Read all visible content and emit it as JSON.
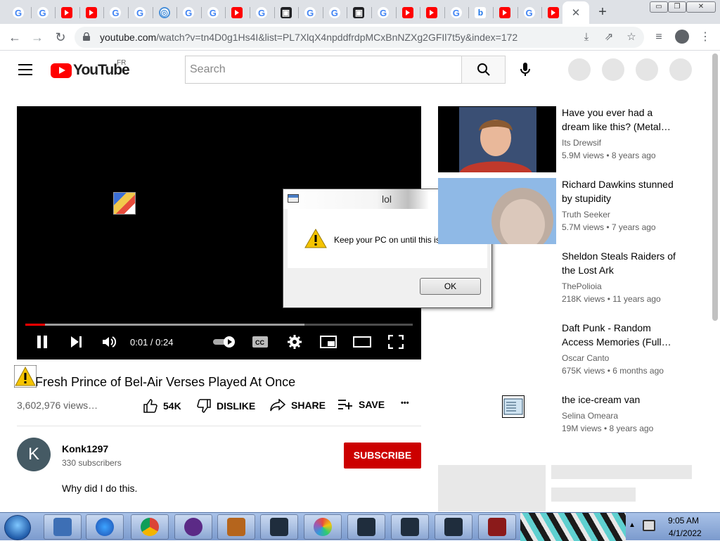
{
  "browser": {
    "tabs": [
      {
        "icon": "google-icon",
        "glyph": "G"
      },
      {
        "icon": "google-icon",
        "glyph": "G"
      },
      {
        "icon": "youtube-icon",
        "glyph": ""
      },
      {
        "icon": "youtube-icon",
        "glyph": ""
      },
      {
        "icon": "google-icon",
        "glyph": "G"
      },
      {
        "icon": "google-icon",
        "glyph": "G"
      },
      {
        "icon": "web-icon",
        "glyph": "◎"
      },
      {
        "icon": "google-icon",
        "glyph": "G"
      },
      {
        "icon": "google-icon",
        "glyph": "G"
      },
      {
        "icon": "youtube-icon",
        "glyph": ""
      },
      {
        "icon": "google-icon",
        "glyph": "G"
      },
      {
        "icon": "robot-icon",
        "glyph": "▣"
      },
      {
        "icon": "google-icon",
        "glyph": "G"
      },
      {
        "icon": "google-icon",
        "glyph": "G"
      },
      {
        "icon": "robot-icon",
        "glyph": "▣"
      },
      {
        "icon": "google-icon",
        "glyph": "G"
      },
      {
        "icon": "youtube-icon",
        "glyph": ""
      },
      {
        "icon": "youtube-icon",
        "glyph": ""
      },
      {
        "icon": "google-icon",
        "glyph": "G"
      },
      {
        "icon": "bing-icon",
        "glyph": "b"
      },
      {
        "icon": "youtube-icon",
        "glyph": ""
      },
      {
        "icon": "google-icon",
        "glyph": "G"
      },
      {
        "icon": "youtube-icon",
        "glyph": ""
      }
    ],
    "close_tab": "✕",
    "new_tab": "+",
    "window_buttons": [
      "▭",
      "❐",
      "✕"
    ],
    "url_host": "youtube.com",
    "url_path": "/watch?v=tn4D0g1Hs4I&list=PL7XlqX4npddfrdpMCxBnNZXg2GFIl7t5y&index=172"
  },
  "youtube": {
    "logo_text": "YouTube",
    "country": "FR",
    "search_placeholder": "Search"
  },
  "player": {
    "time": "0:01 / 0:24",
    "progress_fraction": 0.05,
    "buffer_fraction": 0.72
  },
  "dialog": {
    "title": "lol",
    "message": "Keep your PC on until this is done.",
    "ok_label": "OK",
    "close_label": "✕"
  },
  "video": {
    "title": "Fresh Prince of Bel-Air Verses Played At Once",
    "views": "3,602,976 views…",
    "likes": "54K",
    "dislike_label": "DISLIKE",
    "share_label": "SHARE",
    "save_label": "SAVE",
    "more_label": "•••"
  },
  "channel": {
    "avatar_letter": "K",
    "name": "Konk1297",
    "subscribers": "330 subscribers",
    "subscribe_label": "SUBSCRIBE",
    "description": "Why did I do this."
  },
  "recommendations": [
    {
      "title_line1": "Have you ever had a",
      "title_line2": "dream like this? (Metal…",
      "channel": "Its Drewsif",
      "meta": "5.9M views • 8 years ago"
    },
    {
      "title_line1": "Richard Dawkins stunned",
      "title_line2": "by stupidity",
      "channel": "Truth Seeker",
      "meta": "5.7M views • 7 years ago"
    },
    {
      "title_line1": "Sheldon Steals Raiders of",
      "title_line2": "the Lost Ark",
      "channel": "ThePolioia",
      "meta": "218K views • 11 years ago"
    },
    {
      "title_line1": "Daft Punk - Random",
      "title_line2": "Access Memories (Full…",
      "channel": "Oscar Canto",
      "meta": "675K views • 6 months ago"
    },
    {
      "title_line1": "the ice-cream van",
      "title_line2": "",
      "channel": "Selina Omeara",
      "meta": "19M views • 8 years ago"
    }
  ],
  "taskbar": {
    "time": "9:05 AM",
    "date": "4/1/2022"
  },
  "colors": {
    "youtube_red": "#ff0000",
    "subscribe_red": "#cc0000",
    "progress_red": "#ff0000"
  }
}
